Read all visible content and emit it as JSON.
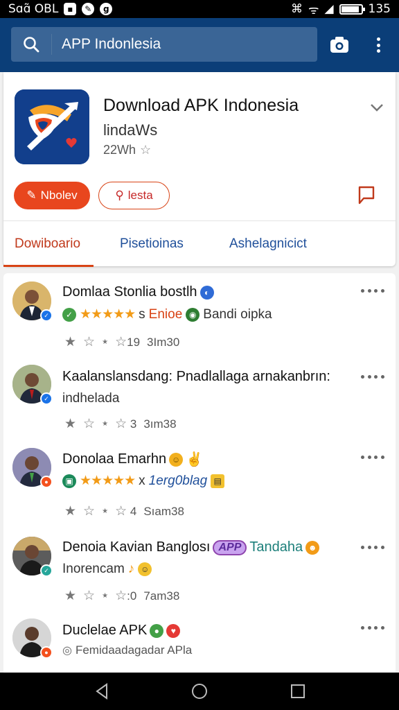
{
  "status_bar": {
    "left_text": "Sɑɑ̃ OBL",
    "time": "135",
    "battery_fraction": 0.85
  },
  "search": {
    "value": "APP Indonlesia",
    "icons": [
      "search-icon",
      "camera-icon",
      "more-vert-icon"
    ]
  },
  "app": {
    "title": "Download APK Indonesia",
    "subtitle": "lindaWs",
    "meta": "22Wh",
    "primary_button": "Nbolev",
    "secondary_button": "Ɩesta"
  },
  "tabs": [
    {
      "label": "Dowiboario",
      "active": true
    },
    {
      "label": "Pisetioinas",
      "active": false
    },
    {
      "label": "Ashelagnicict",
      "active": false
    }
  ],
  "items": [
    {
      "title": "Domlaa Stonlia bostlh",
      "line2_stars": "★★★★★",
      "line2_a": "s",
      "line2_b": "Enioe",
      "line2_c": "Bandi oipka",
      "stat_num": "19",
      "stat_time": "3Im30"
    },
    {
      "title": "Kaalanslansdang: Pnadlallaga arnakanbrın:",
      "line2": "indhelada",
      "stat_num": "3",
      "stat_time": "3ım38"
    },
    {
      "title": "Donolaa Emarhn",
      "line2_stars": "★★★★★",
      "line2_a": "x",
      "line2_b": "1erg0blag",
      "stat_num": "4",
      "stat_time": "Sıam38"
    },
    {
      "title": "Denoia Kavian Banglosı",
      "title_pill": "APP",
      "title_suffix": "Tandaha",
      "line2": "Inorencam",
      "stat_num": "0",
      "stat_time": "7am38"
    },
    {
      "title": "Duclelae APK",
      "line2": "Femidaadagadar APla"
    }
  ]
}
